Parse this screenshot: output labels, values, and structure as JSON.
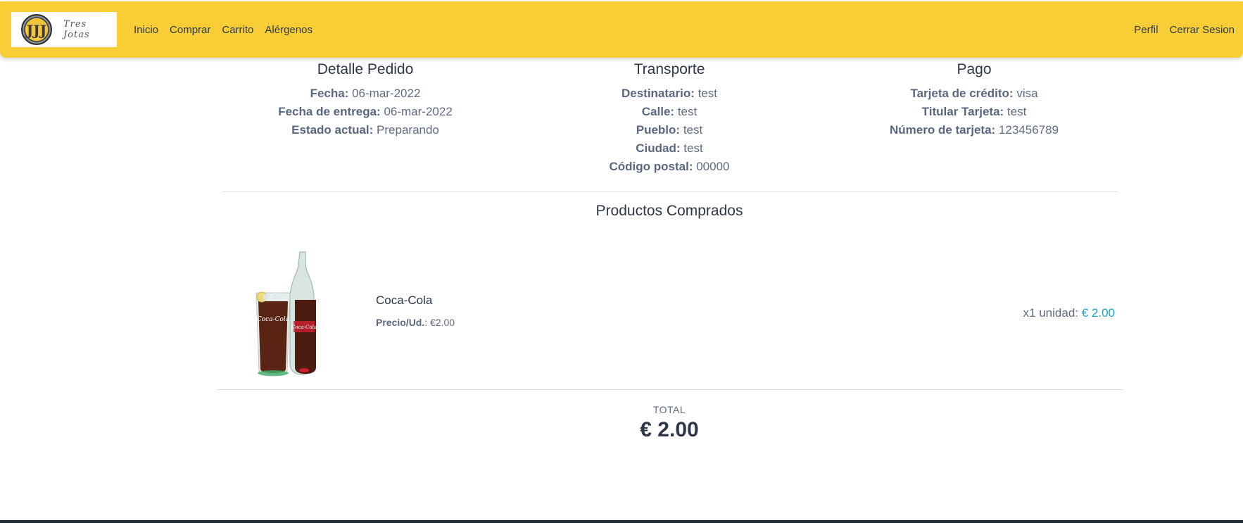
{
  "navbar": {
    "logo_text": "Tres Jotas",
    "left_links": [
      "Inicio",
      "Comprar",
      "Carrito",
      "Alérgenos"
    ],
    "right_links": [
      "Perfil",
      "Cerrar Sesion"
    ],
    "background_color": "#f9cd35"
  },
  "detalle": {
    "title": "Detalle Pedido",
    "fecha_label": "Fecha:",
    "fecha": "06-mar-2022",
    "entrega_label": "Fecha de entrega:",
    "entrega": "06-mar-2022",
    "estado_label": "Estado actual:",
    "estado": "Preparando"
  },
  "transporte": {
    "title": "Transporte",
    "destinatario_label": "Destinatario:",
    "destinatario": "test",
    "calle_label": "Calle:",
    "calle": "test",
    "pueblo_label": "Pueblo:",
    "pueblo": "test",
    "ciudad_label": "Ciudad:",
    "ciudad": "test",
    "cp_label": "Código postal:",
    "cp": "00000"
  },
  "pago": {
    "title": "Pago",
    "tarjeta_label": "Tarjeta de crédito:",
    "tarjeta": "visa",
    "titular_label": "Titular Tarjeta:",
    "titular": "test",
    "numero_label": "Número de tarjeta:",
    "numero": "123456789"
  },
  "productos": {
    "title": "Productos Comprados",
    "items": [
      {
        "name": "Coca-Cola",
        "unit_price_label": "Precio/Ud.",
        "unit_price": ": €2.00",
        "qty_text": "x1 unidad: ",
        "line_total": "€ 2.00"
      }
    ]
  },
  "total": {
    "label": "TOTAL",
    "value": "€ 2.00"
  },
  "colors": {
    "accent_price": "#1fa3c3",
    "text_dark": "#2d3748"
  }
}
